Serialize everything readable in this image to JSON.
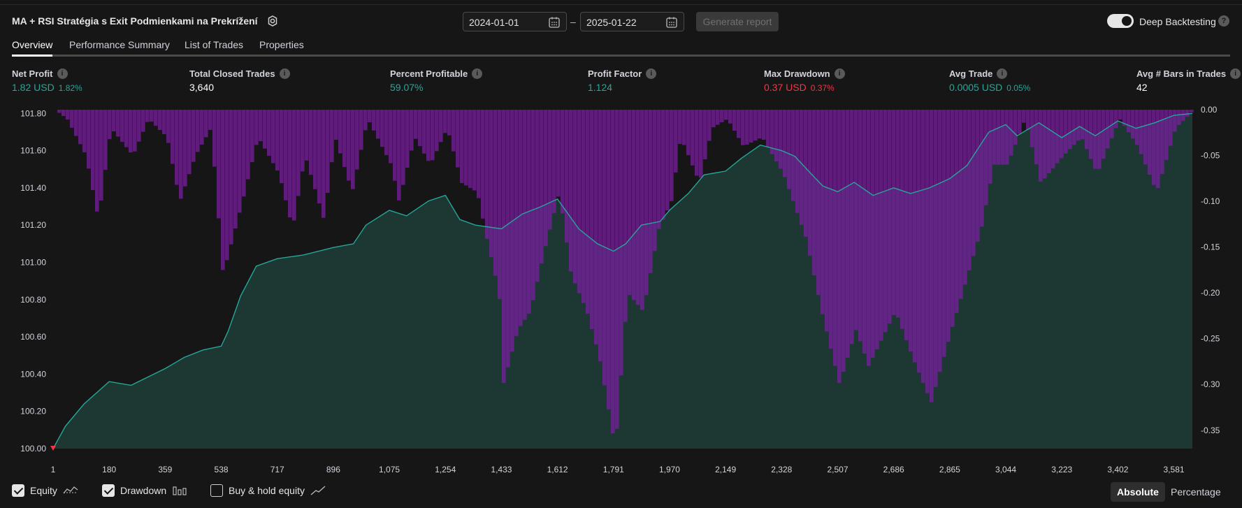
{
  "header": {
    "title": "MA + RSI Stratégia s Exit Podmienkami na Prekrížení",
    "date_from": "2024-01-01",
    "date_sep": "–",
    "date_to": "2025-01-22",
    "generate_label": "Generate report",
    "deep_backtesting_label": "Deep Backtesting",
    "deep_backtesting_on": true
  },
  "tabs": [
    {
      "label": "Overview",
      "active": true
    },
    {
      "label": "Performance Summary",
      "active": false
    },
    {
      "label": "List of Trades",
      "active": false
    },
    {
      "label": "Properties",
      "active": false
    }
  ],
  "metrics": [
    {
      "label": "Net Profit",
      "value": "1.82 USD",
      "pct": "1.82%",
      "color": "#26a69a"
    },
    {
      "label": "Total Closed Trades",
      "value": "3,640",
      "pct": "",
      "color": "#ffffff"
    },
    {
      "label": "Percent Profitable",
      "value": "59.07%",
      "pct": "",
      "color": "#26a69a"
    },
    {
      "label": "Profit Factor",
      "value": "1.124",
      "pct": "",
      "color": "#26a69a"
    },
    {
      "label": "Max Drawdown",
      "value": "0.37 USD",
      "pct": "0.37%",
      "color": "#f23645"
    },
    {
      "label": "Avg Trade",
      "value": "0.0005 USD",
      "pct": "0.05%",
      "color": "#26a69a"
    },
    {
      "label": "Avg # Bars in Trades",
      "value": "42",
      "pct": "",
      "color": "#ffffff"
    }
  ],
  "chart_data": {
    "type": "area",
    "x_ticks": [
      "1",
      "180",
      "359",
      "538",
      "717",
      "896",
      "1,075",
      "1,254",
      "1,433",
      "1,612",
      "1,791",
      "1,970",
      "2,149",
      "2,328",
      "2,507",
      "2,686",
      "2,865",
      "3,044",
      "3,223",
      "3,402",
      "3,581"
    ],
    "x_range": [
      1,
      3640
    ],
    "left_ticks": [
      "100.00",
      "100.20",
      "100.40",
      "100.60",
      "100.80",
      "101.00",
      "101.20",
      "101.40",
      "101.60",
      "101.80"
    ],
    "left_ylim": [
      100.0,
      101.82
    ],
    "right_ticks": [
      "0.00",
      "-0.05",
      "-0.10",
      "-0.15",
      "-0.20",
      "-0.25",
      "-0.30",
      "-0.35"
    ],
    "right_ylim": [
      -0.37,
      0.0
    ],
    "series": [
      {
        "name": "Equity",
        "color": "#26a69a",
        "x": [
          1,
          40,
          100,
          180,
          250,
          359,
          420,
          480,
          538,
          560,
          600,
          650,
          717,
          800,
          896,
          960,
          1000,
          1075,
          1130,
          1200,
          1254,
          1300,
          1350,
          1433,
          1500,
          1560,
          1612,
          1680,
          1740,
          1791,
          1830,
          1880,
          1940,
          1970,
          2030,
          2080,
          2149,
          2200,
          2260,
          2328,
          2370,
          2420,
          2460,
          2507,
          2560,
          2620,
          2686,
          2740,
          2800,
          2865,
          2920,
          2990,
          3044,
          3080,
          3150,
          3223,
          3280,
          3330,
          3402,
          3460,
          3520,
          3581,
          3640
        ],
        "values": [
          100.0,
          100.12,
          100.24,
          100.36,
          100.34,
          100.43,
          100.49,
          100.53,
          100.55,
          100.63,
          100.82,
          100.98,
          101.02,
          101.04,
          101.08,
          101.1,
          101.2,
          101.28,
          101.25,
          101.33,
          101.36,
          101.23,
          101.2,
          101.18,
          101.26,
          101.3,
          101.34,
          101.18,
          101.1,
          101.06,
          101.1,
          101.2,
          101.22,
          101.28,
          101.37,
          101.47,
          101.49,
          101.56,
          101.63,
          101.6,
          101.57,
          101.48,
          101.41,
          101.38,
          101.43,
          101.36,
          101.4,
          101.37,
          101.4,
          101.45,
          101.52,
          101.7,
          101.74,
          101.68,
          101.75,
          101.67,
          101.73,
          101.68,
          101.76,
          101.72,
          101.75,
          101.79,
          101.8
        ]
      },
      {
        "name": "Drawdown",
        "color": "#7b1fa2",
        "x": [
          1,
          40,
          100,
          140,
          180,
          250,
          300,
          359,
          400,
          450,
          500,
          538,
          600,
          650,
          717,
          760,
          800,
          860,
          896,
          950,
          1000,
          1075,
          1100,
          1150,
          1200,
          1254,
          1300,
          1350,
          1380,
          1420,
          1433,
          1480,
          1520,
          1560,
          1612,
          1650,
          1700,
          1740,
          1791,
          1830,
          1880,
          1930,
          1970,
          2000,
          2060,
          2100,
          2149,
          2200,
          2260,
          2328,
          2400,
          2450,
          2507,
          2560,
          2600,
          2686,
          2740,
          2800,
          2865,
          2900,
          2960,
          3000,
          3044,
          3100,
          3150,
          3223,
          3280,
          3330,
          3402,
          3460,
          3520,
          3581,
          3640
        ],
        "values": [
          0.0,
          -0.01,
          -0.05,
          -0.12,
          -0.02,
          -0.05,
          -0.01,
          -0.03,
          -0.1,
          -0.05,
          -0.02,
          -0.18,
          -0.1,
          -0.03,
          -0.07,
          -0.13,
          -0.05,
          -0.12,
          -0.03,
          -0.09,
          -0.01,
          -0.06,
          -0.1,
          -0.03,
          -0.06,
          -0.02,
          -0.08,
          -0.09,
          -0.14,
          -0.2,
          -0.3,
          -0.24,
          -0.22,
          -0.16,
          -0.09,
          -0.18,
          -0.22,
          -0.27,
          -0.37,
          -0.2,
          -0.22,
          -0.13,
          -0.1,
          -0.03,
          -0.08,
          -0.02,
          -0.01,
          -0.04,
          -0.03,
          -0.07,
          -0.14,
          -0.22,
          -0.3,
          -0.24,
          -0.28,
          -0.22,
          -0.27,
          -0.32,
          -0.24,
          -0.2,
          -0.13,
          -0.06,
          -0.06,
          -0.01,
          -0.08,
          -0.05,
          -0.03,
          -0.07,
          -0.01,
          -0.04,
          -0.09,
          -0.02,
          0.0
        ]
      }
    ]
  },
  "footer": {
    "equity_label": "Equity",
    "equity_checked": true,
    "drawdown_label": "Drawdown",
    "drawdown_checked": true,
    "buyhold_label": "Buy & hold equity",
    "buyhold_checked": false,
    "absolute_label": "Absolute",
    "percentage_label": "Percentage"
  }
}
